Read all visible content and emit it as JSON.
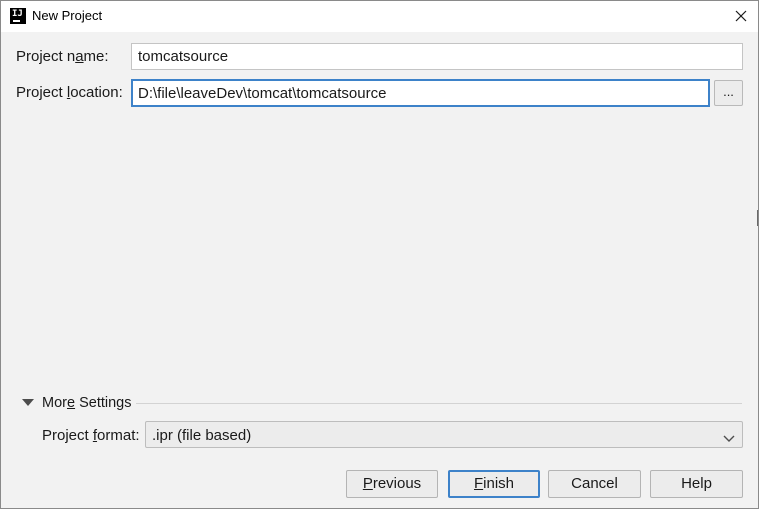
{
  "window": {
    "title": "New Project",
    "app_icon_text": "IJ",
    "close_icon": "close-icon"
  },
  "form": {
    "project_name": {
      "label_pre": "Project n",
      "label_key": "a",
      "label_post": "me:",
      "value": "tomcatsource"
    },
    "project_location": {
      "label_pre": "Project ",
      "label_key": "l",
      "label_post": "ocation:",
      "value": "D:\\file\\leaveDev\\tomcat\\tomcatsource",
      "browse_label": "..."
    }
  },
  "more_settings": {
    "title_pre": "Mor",
    "title_key": "e",
    "title_post": " Settings",
    "expanded": true,
    "toggle_icon": "triangle-down-icon",
    "project_format": {
      "label_pre": "Project ",
      "label_key": "f",
      "label_post": "ormat:",
      "value": ".ipr (file based)",
      "chevron_icon": "chevron-down-icon"
    }
  },
  "buttons": {
    "previous": {
      "key": "P",
      "rest": "revious"
    },
    "finish": {
      "key": "F",
      "rest": "inish"
    },
    "cancel": {
      "label": "Cancel"
    },
    "help": {
      "label": "Help"
    }
  },
  "colors": {
    "focus_accent": "#3d82c9",
    "dialog_background": "#f2f2f2"
  }
}
